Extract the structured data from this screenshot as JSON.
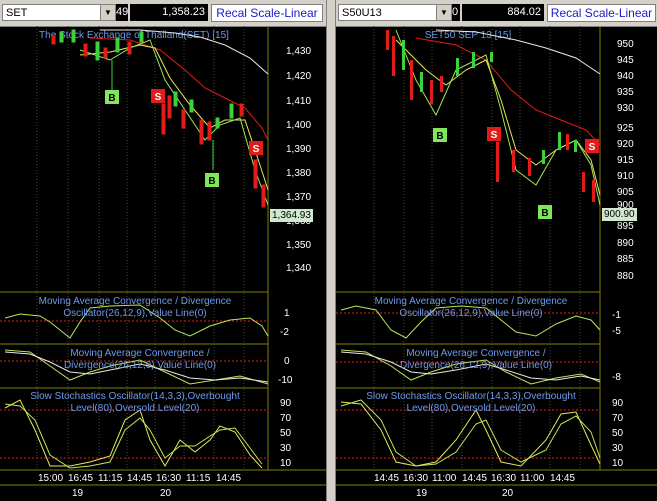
{
  "left": {
    "symbol": "SET",
    "stub": "49",
    "value": "1,358.23",
    "recal_label": "Recal Scale-Linear",
    "title": "The Stock Exchange of Thailand(SET) [15]",
    "last_price": "1,364.93",
    "price_ticks": [
      "1,430",
      "1,420",
      "1,410",
      "1,400",
      "1,390",
      "1,380",
      "1,370",
      "1,360",
      "1,350",
      "1,340"
    ],
    "macd1_title": "Moving Average Convergence / Divergence Oscillator(26,12,9),Value Line(0)",
    "macd1_ticks": [
      "1",
      "-2"
    ],
    "macd2_title": "Moving Average Convergence / Divergence(26,12,9),Value Line(0)",
    "macd2_ticks": [
      "0",
      "-10"
    ],
    "stoch_title": "Slow Stochastics Oscillator(14,3,3),Overbought Level(80),Oversold Level(20)",
    "stoch_ticks": [
      "90",
      "70",
      "50",
      "30",
      "10"
    ],
    "time_labels": [
      "15:00",
      "16:45",
      "11:15",
      "14:45",
      "16:30",
      "11:15",
      "14:45"
    ],
    "date_labels": [
      "19",
      "20"
    ],
    "signals": [
      "B",
      "S",
      "B",
      "S"
    ]
  },
  "right": {
    "symbol": "S50U13",
    "stub": "0",
    "value": "884.02",
    "recal_label": "Recal Scale-Linear",
    "title": "SET50 SEP 13  [15]",
    "last_price": "900.90",
    "price_ticks": [
      "950",
      "945",
      "940",
      "935",
      "930",
      "925",
      "920",
      "915",
      "910",
      "905",
      "900",
      "895",
      "890",
      "885",
      "880"
    ],
    "macd1_title": "Moving Average Convergence / Divergence Oscillator(26,12,9),Value Line(0)",
    "macd1_ticks": [
      "-1",
      "-5"
    ],
    "macd2_title": "Moving Average Convergence / Divergence(26,12,9),Value Line(0)",
    "macd2_ticks": [
      "-8"
    ],
    "stoch_title": "Slow Stochastics Oscillator(14,3,3),Overbought Level(80),Oversold Level(20)",
    "stoch_ticks": [
      "90",
      "70",
      "50",
      "30",
      "10"
    ],
    "time_labels": [
      "14:45",
      "16:30",
      "11:00",
      "14:45",
      "16:30",
      "11:00",
      "14:45"
    ],
    "date_labels": [
      "19",
      "20"
    ],
    "signals": [
      "B",
      "S",
      "B",
      "S"
    ]
  },
  "colors": {
    "buy": "#7fe85a",
    "sell": "#e41b1b",
    "axis": "#808000",
    "title": "#6e9ae8"
  }
}
